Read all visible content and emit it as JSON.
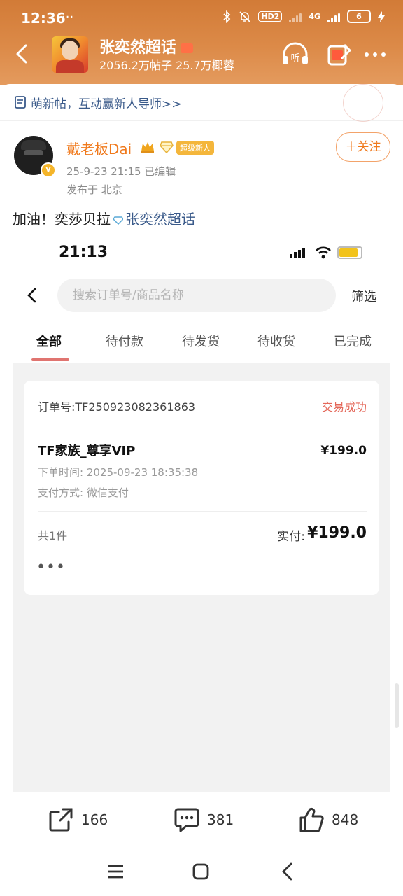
{
  "status_bar": {
    "time": "12:36",
    "misc": "···",
    "hd_label": "HD2",
    "network_label": "4G",
    "battery": "6"
  },
  "header": {
    "topic_title": "张奕然超话",
    "topic_stats": "2056.2万帖子 25.7万椰蓉"
  },
  "notice": {
    "text": "萌新帖，互动赢新人导师>>"
  },
  "post": {
    "username": "戴老板Dai",
    "badge_label": "超级新人",
    "verified_mark": "V",
    "meta": "25-9-23 21:15  已编辑",
    "location": "发布于 北京",
    "follow_label": "＋关注",
    "text_prefix": "加油！奕莎贝拉",
    "topic_link": "张奕然超话"
  },
  "embedded_screenshot": {
    "time": "21:13",
    "search_placeholder": "搜索订单号/商品名称",
    "filter_label": "筛选",
    "tabs": [
      "全部",
      "待付款",
      "待发货",
      "待收货",
      "已完成"
    ],
    "active_tab": 0,
    "battery_level": 0.8,
    "battery_color": "#f2c31c",
    "order": {
      "order_number": "订单号:TF250923082361863",
      "status": "交易成功",
      "product_name": "TF家族_尊享VIP",
      "price": "¥199.0",
      "order_time": "下单时间: 2025-09-23 18:35:38",
      "pay_method": "支付方式: 微信支付",
      "item_count": "共1件",
      "paid_label": "实付:",
      "paid_amount": "¥199.0",
      "more": "•••"
    }
  },
  "actions": {
    "share_count": "166",
    "comment_count": "381",
    "like_count": "848"
  },
  "colors": {
    "header_gradient_top": "#d27b37",
    "username_orange": "#f07a1d",
    "topic_link_blue": "#3a5a8a",
    "status_red": "#e4685a",
    "tab_underline": "#e07470"
  }
}
